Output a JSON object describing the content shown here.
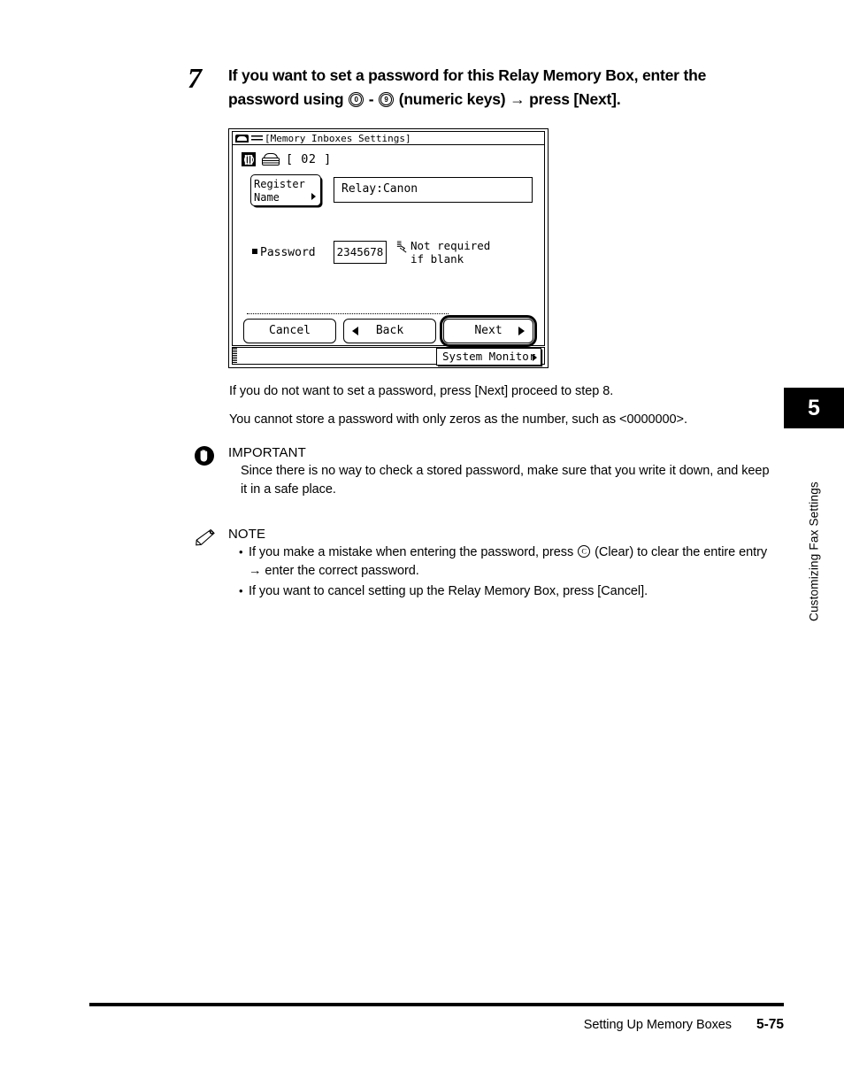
{
  "step": {
    "number": "7",
    "text_before_keys": "If you want to set a password for this Relay Memory Box, enter the password using ",
    "key_low": "0",
    "key_sep": " - ",
    "key_high": "9",
    "text_after_keys": " (numeric keys) ",
    "arrow": "→",
    "text_end": " press [Next]."
  },
  "lcd": {
    "title_bar": {
      "icon_a": "network-card-icon",
      "icon_b": "list-icon",
      "title": "[Memory Inboxes Settings]"
    },
    "header": {
      "globe_icon": "globe-icon",
      "fax_icon": "fax-machine-icon",
      "box_number": "[ 02 ]"
    },
    "register_name_button": "Register\nName",
    "register_name_line1": "Register",
    "register_name_line2": "Name",
    "name_value": "Relay:Canon",
    "password_label": "Password",
    "password_value": "2345678",
    "password_hint_line1": "Not required",
    "password_hint_line2": "if blank",
    "buttons": {
      "cancel": "Cancel",
      "back": "Back",
      "next": "Next"
    },
    "status_bar": {
      "system_monitor": "System Monitor"
    }
  },
  "body": {
    "para_1": "If you do not want to set a password, press [Next] proceed to step 8.",
    "para_2": "You cannot store a password with only zeros as the number, such as <0000000>."
  },
  "important": {
    "heading": "IMPORTANT",
    "body": "Since there is no way to check a stored password, make sure that you write it down, and keep it in a safe place."
  },
  "note": {
    "heading": "NOTE",
    "item_1_part_1": "If you make a mistake when entering the password, press ",
    "clear_key_glyph": "C",
    "item_1_part_2": " (Clear) to clear the entire entry ",
    "item_1_arrow": "→",
    "item_1_part_3": " enter the correct password.",
    "item_2": "If you want to cancel setting up the Relay Memory Box, press [Cancel]."
  },
  "chapter": {
    "number": "5",
    "title": "Customizing Fax Settings"
  },
  "footer": {
    "section_title": "Setting Up Memory Boxes",
    "page_number": "5-75"
  }
}
